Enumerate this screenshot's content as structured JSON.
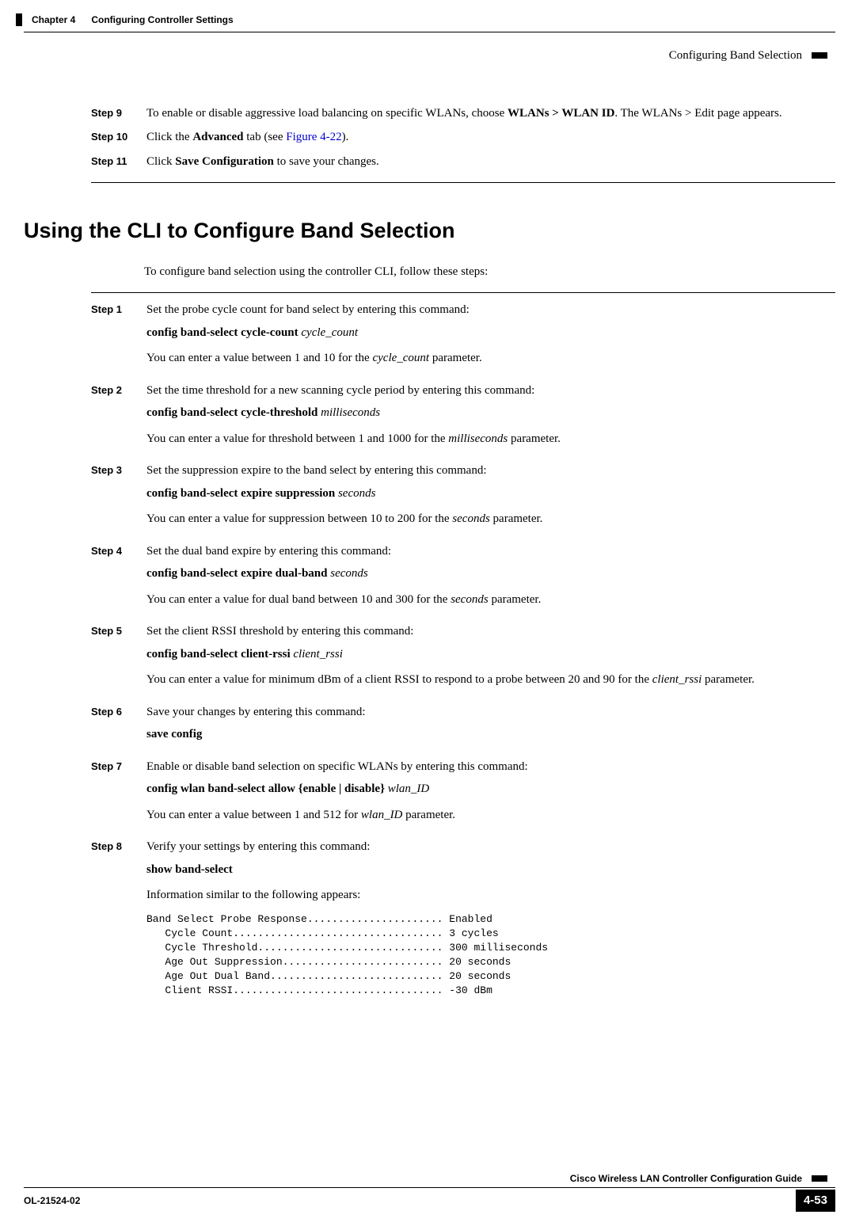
{
  "header": {
    "chapter": "Chapter 4",
    "title": "Configuring Controller Settings",
    "right": "Configuring Band Selection"
  },
  "steps_a": {
    "s9": {
      "num": "Step 9",
      "p1a": "To enable or disable aggressive load balancing on specific WLANs, choose ",
      "p1b": "WLANs > WLAN ID",
      "p1c": ". The WLANs > Edit page appears."
    },
    "s10": {
      "num": "Step 10",
      "p1a": "Click the ",
      "p1b": "Advanced",
      "p1c": " tab (see ",
      "p1link": "Figure 4-22",
      "p1d": ")."
    },
    "s11": {
      "num": "Step 11",
      "p1a": "Click ",
      "p1b": "Save Configuration",
      "p1c": " to save your changes."
    }
  },
  "section": {
    "heading": "Using the CLI to Configure Band Selection",
    "intro": "To configure band selection using the controller CLI, follow these steps:"
  },
  "steps_b": {
    "s1": {
      "num": "Step 1",
      "p1": "Set the probe cycle count for band select by entering this command:",
      "cmd_a": "config band-select cycle-count ",
      "cmd_i": "cycle_count",
      "p2a": "You can enter a value between 1 and 10 for the ",
      "p2i": "cycle_count",
      "p2b": " parameter."
    },
    "s2": {
      "num": "Step 2",
      "p1": "Set the time threshold for a new scanning cycle period by entering this command:",
      "cmd_a": "config band-select cycle-threshold ",
      "cmd_i": "milliseconds",
      "p2a": "You can enter a value for threshold between 1 and 1000 for the ",
      "p2i": "milliseconds",
      "p2b": " parameter."
    },
    "s3": {
      "num": "Step 3",
      "p1": "Set the suppression expire to the band select by entering this command:",
      "cmd_a": "config band-select expire suppression ",
      "cmd_i": "seconds",
      "p2a": "You can enter a value for suppression between 10 to 200 for the ",
      "p2i": "seconds",
      "p2b": " parameter."
    },
    "s4": {
      "num": "Step 4",
      "p1": "Set the dual band expire by entering this command:",
      "cmd_a": "config band-select expire dual-band ",
      "cmd_i": "seconds",
      "p2a": "You can enter a value for dual band between 10 and 300 for the ",
      "p2i": "seconds",
      "p2b": " parameter."
    },
    "s5": {
      "num": "Step 5",
      "p1": "Set the client RSSI threshold by entering this command:",
      "cmd_a": "config band-select client-rssi ",
      "cmd_i": "client_rssi",
      "p2a": "You can enter a value for minimum dBm of a client RSSI to respond to a probe between 20 and 90 for the ",
      "p2i": "client_rssi",
      "p2b": " parameter."
    },
    "s6": {
      "num": "Step 6",
      "p1": "Save your changes by entering this command:",
      "cmd_a": "save config"
    },
    "s7": {
      "num": "Step 7",
      "p1": "Enable or disable band selection on specific WLANs by entering this command:",
      "cmd_a": "config wlan band-select allow {enable | disable} ",
      "cmd_i": "wlan_ID",
      "p2a": "You can enter a value between 1 and 512 for ",
      "p2i": "wlan_ID",
      "p2b": " parameter."
    },
    "s8": {
      "num": "Step 8",
      "p1": "Verify your settings by entering this command:",
      "cmd_a": "show band-select",
      "p2": "Information similar to the following appears:",
      "output": "Band Select Probe Response...................... Enabled\n   Cycle Count.................................. 3 cycles\n   Cycle Threshold.............................. 300 milliseconds\n   Age Out Suppression.......................... 20 seconds\n   Age Out Dual Band............................ 20 seconds\n   Client RSSI.................................. -30 dBm"
    }
  },
  "footer": {
    "guide": "Cisco Wireless LAN Controller Configuration Guide",
    "doc": "OL-21524-02",
    "pagenum": "4-53"
  }
}
